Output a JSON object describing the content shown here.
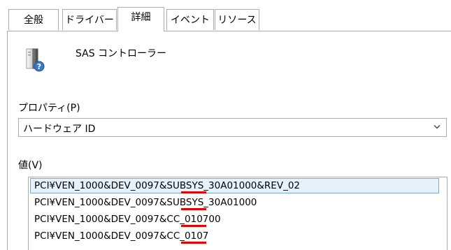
{
  "tabs": [
    "全般",
    "ドライバー",
    "詳細",
    "イベント",
    "リソース"
  ],
  "active_tab_index": 2,
  "device": {
    "name": "SAS コントローラー",
    "icon": "device-help-icon"
  },
  "property": {
    "label": "プロパティ(P)",
    "selected": "ハードウェア ID"
  },
  "value": {
    "label": "値(V)",
    "items": [
      "PCI¥VEN_1000&DEV_0097&SUBSYS_30A01000&REV_02",
      "PCI¥VEN_1000&DEV_0097&SUBSYS_30A01000",
      "PCI¥VEN_1000&DEV_0097&CC_010700",
      "PCI¥VEN_1000&DEV_0097&CC_0107"
    ],
    "selected_index": 0,
    "highlight_text": "0097",
    "highlight_color": "#e60000"
  }
}
